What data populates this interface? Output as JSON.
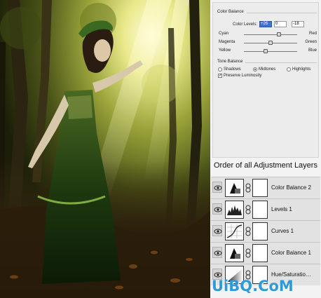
{
  "color_balance": {
    "group_title": "Color Balance",
    "levels_label": "Color Levels:",
    "levels": [
      "+26",
      "0",
      "-18"
    ],
    "sliders": [
      {
        "left": "Cyan",
        "right": "Red",
        "value": 26
      },
      {
        "left": "Magenta",
        "right": "Green",
        "value": 0
      },
      {
        "left": "Yellow",
        "right": "Blue",
        "value": -18
      }
    ]
  },
  "tone_balance": {
    "group_title": "Tone Balance",
    "options": [
      "Shadows",
      "Midtones",
      "Highlights"
    ],
    "selected": "Midtones",
    "preserve_label": "Preserve Luminosity",
    "preserve_checked": true
  },
  "layers_panel": {
    "title": "Order of all Adjustment Layers",
    "layers": [
      {
        "name": "Color Balance 2",
        "icon": "color-balance-icon"
      },
      {
        "name": "Levels 1",
        "icon": "levels-icon"
      },
      {
        "name": "Curves 1",
        "icon": "curves-icon"
      },
      {
        "name": "Color Balance 1",
        "icon": "color-balance-icon"
      },
      {
        "name": "Hue/Saturatio…",
        "icon": "hue-saturation-icon"
      }
    ]
  },
  "watermark": "UiBQ.CoM"
}
